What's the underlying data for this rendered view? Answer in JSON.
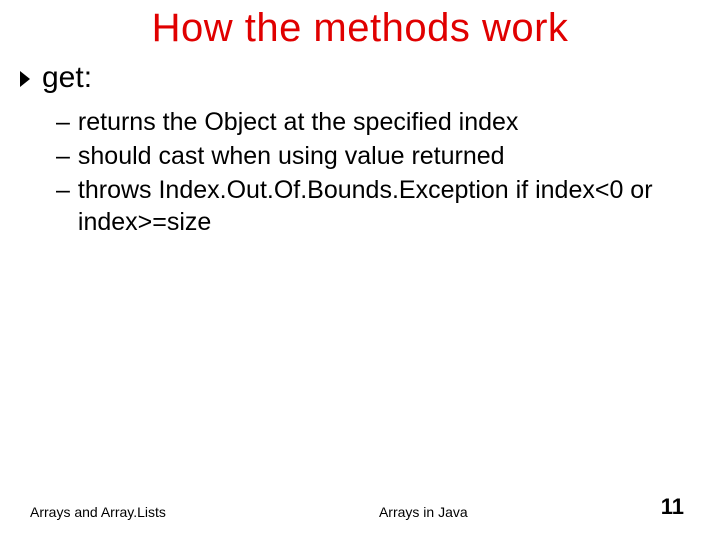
{
  "title": "How the methods work",
  "bullets": {
    "lvl1": "get:",
    "lvl2": [
      "returns the Object at the specified index",
      "should cast when using value returned",
      "throws Index.Out.Of.Bounds.Exception if index<0 or index>=size"
    ]
  },
  "footer": {
    "left": "Arrays and Array.Lists",
    "center": "Arrays in Java",
    "page": "11"
  },
  "colors": {
    "title": "#e00000"
  }
}
